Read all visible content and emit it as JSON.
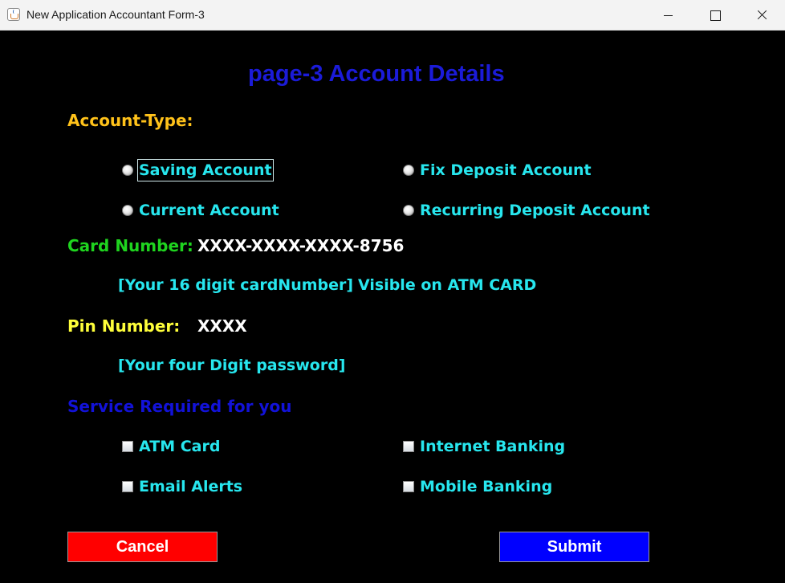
{
  "window": {
    "title": "New Application Accountant Form-3",
    "controls": {
      "minimize": "minimize",
      "maximize": "maximize",
      "close": "close"
    }
  },
  "form": {
    "heading": "page-3 Account Details",
    "account_type": {
      "label": "Account-Type:",
      "options": [
        {
          "label": "Saving Account",
          "selected": false,
          "focused": true
        },
        {
          "label": "Fix Deposit Account",
          "selected": false,
          "focused": false
        },
        {
          "label": "Current Account",
          "selected": false,
          "focused": false
        },
        {
          "label": "Recurring Deposit Account",
          "selected": false,
          "focused": false
        }
      ]
    },
    "card_number": {
      "label": "Card Number:",
      "value": "XXXX-XXXX-XXXX-8756",
      "hint_left": "[Your 16 digit cardNumber]",
      "hint_right": "Visible on ATM CARD"
    },
    "pin_number": {
      "label": "Pin Number:",
      "value": "XXXX",
      "hint": "[Your four Digit password]"
    },
    "services": {
      "label": "Service Required for you",
      "options": [
        {
          "label": "ATM Card",
          "checked": false
        },
        {
          "label": "Internet Banking",
          "checked": false
        },
        {
          "label": "Email Alerts",
          "checked": false
        },
        {
          "label": "Mobile Banking",
          "checked": false
        }
      ]
    },
    "buttons": {
      "cancel": "Cancel",
      "submit": "Submit"
    }
  },
  "colors": {
    "background": "#000000",
    "heading": "#1b1bd8",
    "account_type_label": "#ffc21a",
    "card_label": "#1fd41f",
    "pin_label": "#ffff3a",
    "services_label": "#1212d8",
    "option_text": "#27e6ee",
    "cancel_button": "#ff0000",
    "submit_button": "#0000ff"
  }
}
